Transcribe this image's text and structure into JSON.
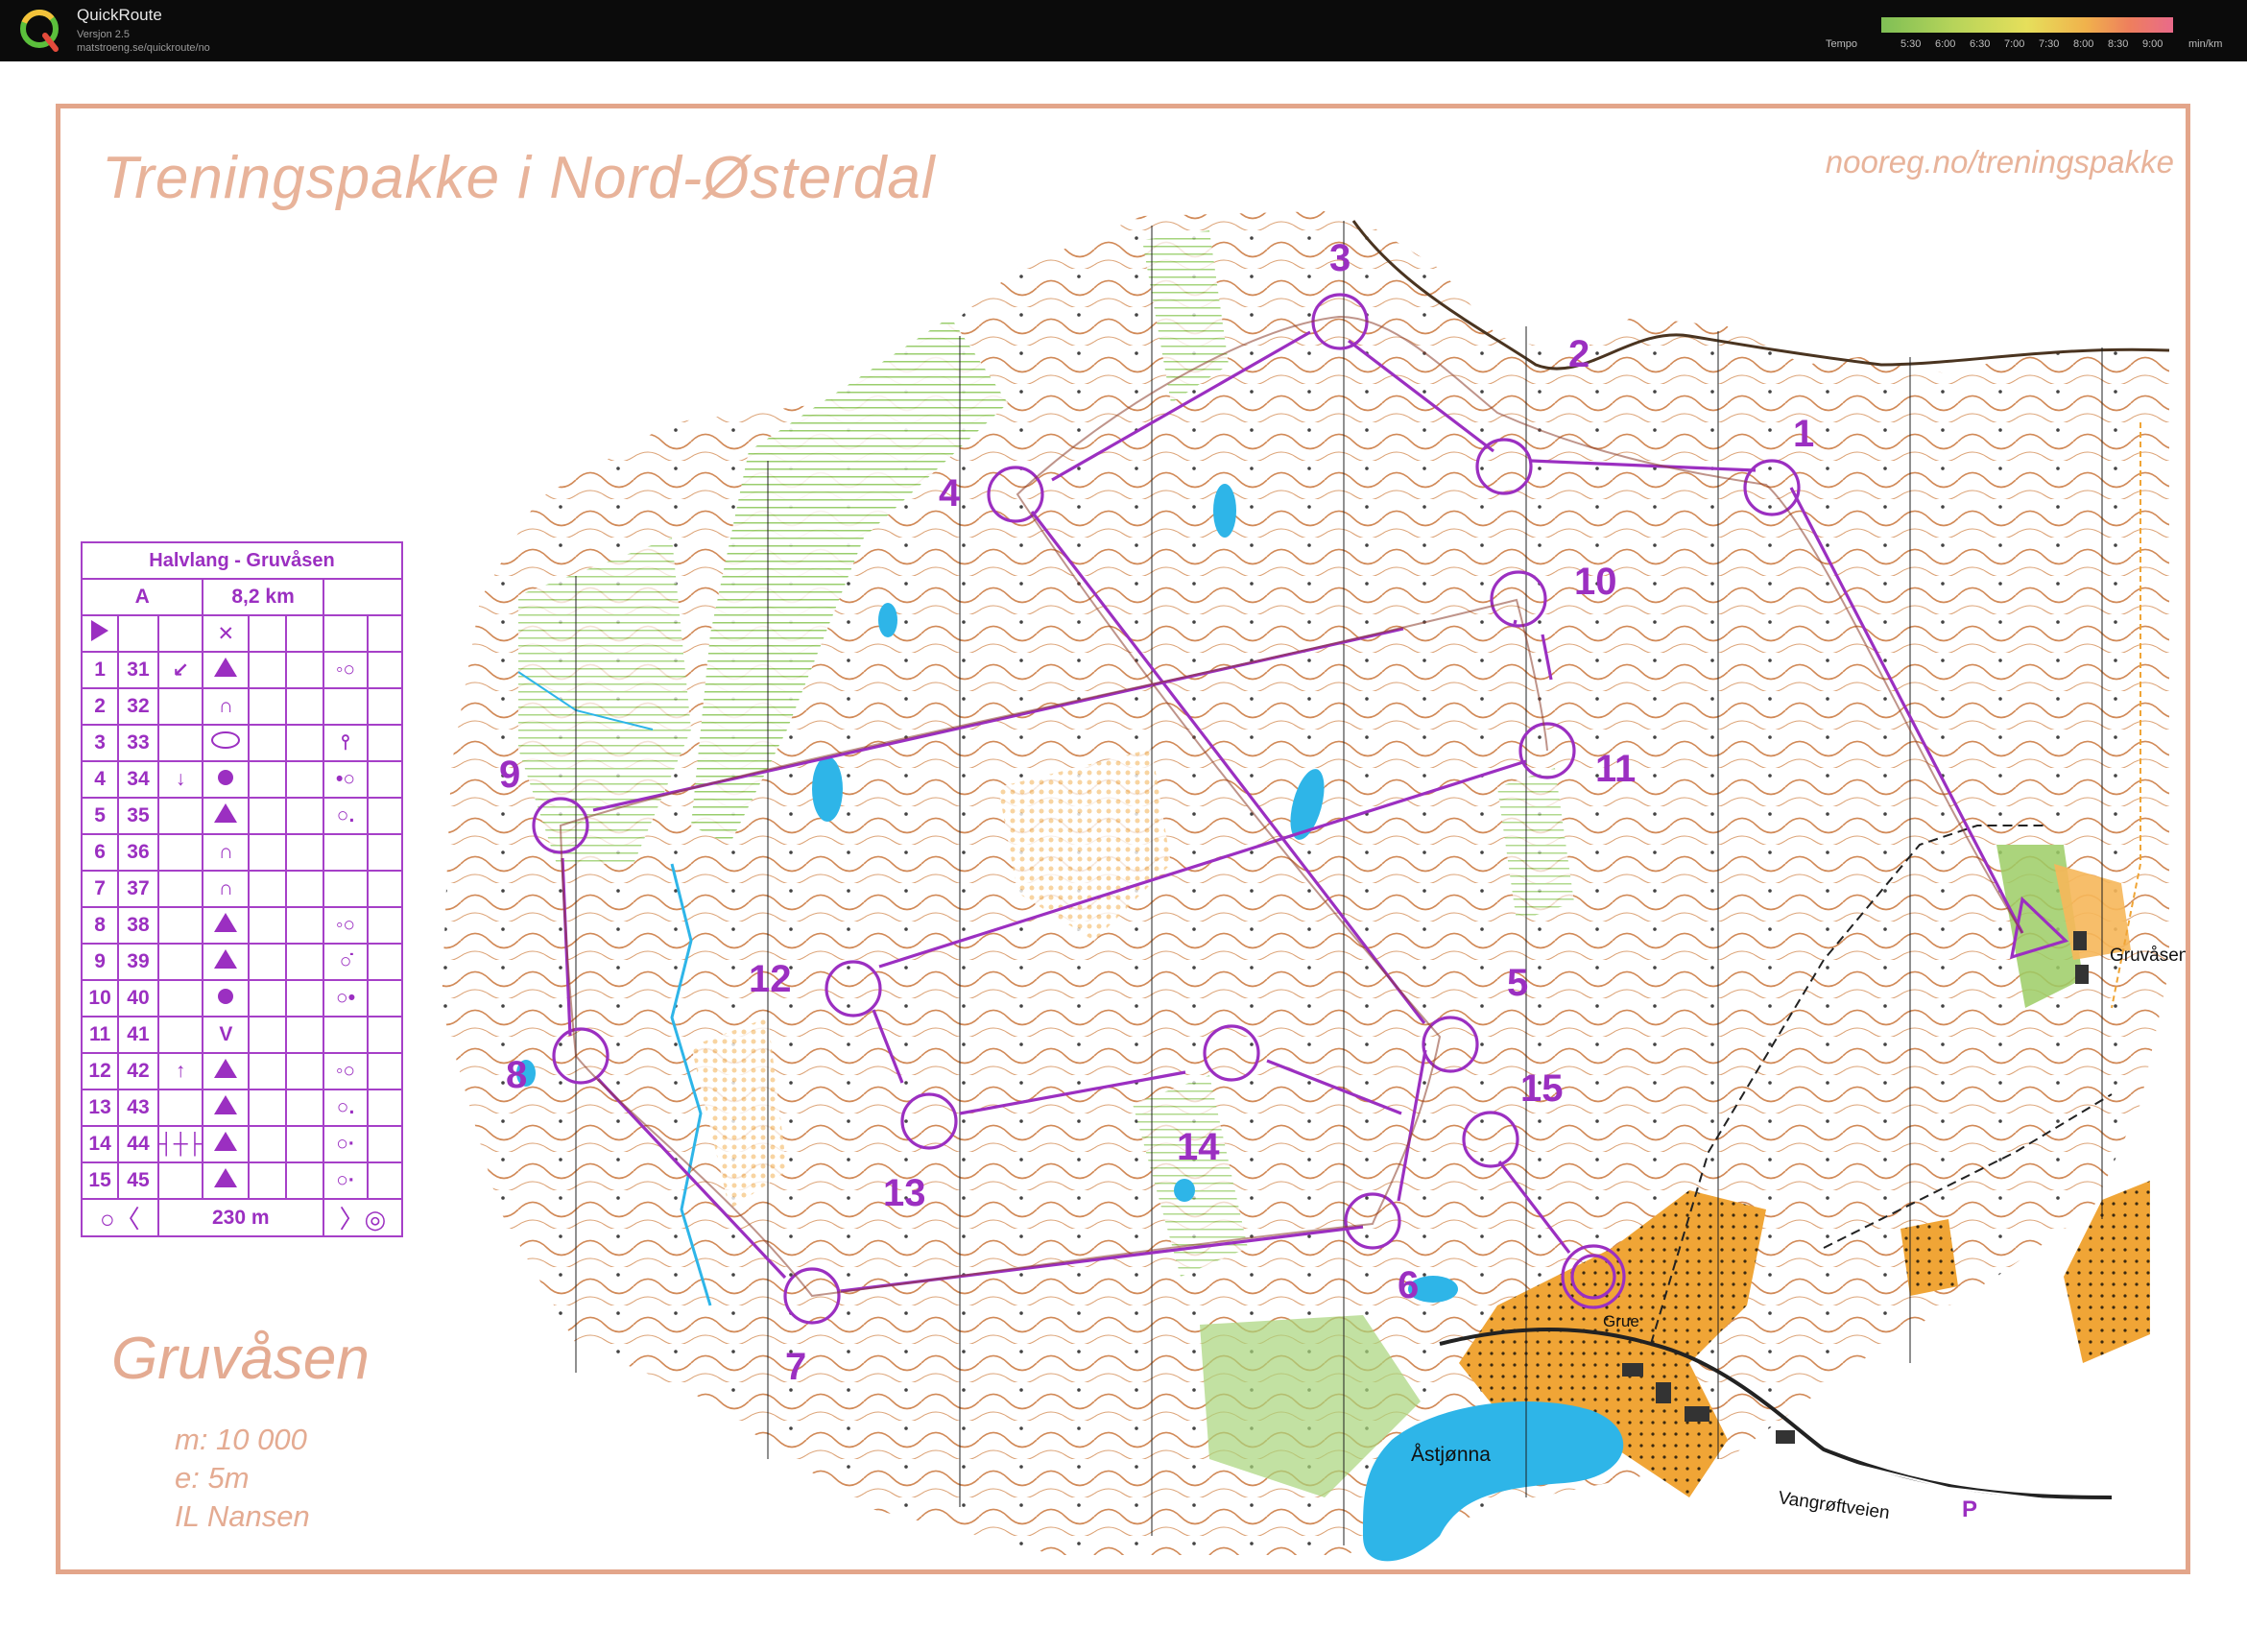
{
  "app": {
    "name": "QuickRoute",
    "version": "Versjon 2.5",
    "url": "matstroeng.se/quickroute/no",
    "tempo_label": "Tempo",
    "tempo_ticks": [
      "5:30",
      "6:00",
      "6:30",
      "7:00",
      "7:30",
      "8:00",
      "8:30",
      "9:00"
    ],
    "tempo_unit": "min/km"
  },
  "map": {
    "title": "Treningspakke i Nord-Østerdal",
    "url": "nooreg.no/treningspakke",
    "area_name": "Gruvåsen",
    "scale": "m: 10 000",
    "equidistance": "e:  5m",
    "club": "IL Nansen",
    "place_labels": {
      "gruvasen": "Gruvåsen",
      "grue": "Grue",
      "astjonna": "Åstjønna",
      "road": "Vangrøftveien",
      "parking": "P"
    },
    "controls": [
      {
        "num": "1"
      },
      {
        "num": "2"
      },
      {
        "num": "3"
      },
      {
        "num": "4"
      },
      {
        "num": "5"
      },
      {
        "num": "6"
      },
      {
        "num": "7"
      },
      {
        "num": "8"
      },
      {
        "num": "9"
      },
      {
        "num": "10"
      },
      {
        "num": "11"
      },
      {
        "num": "12"
      },
      {
        "num": "13"
      },
      {
        "num": "14"
      },
      {
        "num": "15"
      }
    ],
    "colors": {
      "course": "#9b2fc1",
      "frame": "#e3a58a",
      "water": "#2eb5e8",
      "contour": "#c9753a",
      "vegetation": "#9ccc65",
      "open_land": "#f1b96a",
      "settlement": "#f0a536"
    }
  },
  "description": {
    "course_name": "Halvlang - Gruvåsen",
    "class": "A",
    "length": "8,2 km",
    "finish_distance": "230 m",
    "rows": [
      {
        "num": "1",
        "code": "31",
        "dir": "↙",
        "feature": "triangle",
        "extra": "◦○"
      },
      {
        "num": "2",
        "code": "32",
        "dir": "",
        "feature": "∩",
        "extra": ""
      },
      {
        "num": "3",
        "code": "33",
        "dir": "",
        "feature": "oval",
        "extra": "⫯"
      },
      {
        "num": "4",
        "code": "34",
        "dir": "↓",
        "feature": "dot",
        "extra": "•○"
      },
      {
        "num": "5",
        "code": "35",
        "dir": "",
        "feature": "triangle",
        "extra": "○."
      },
      {
        "num": "6",
        "code": "36",
        "dir": "",
        "feature": "∩",
        "extra": ""
      },
      {
        "num": "7",
        "code": "37",
        "dir": "",
        "feature": "∩",
        "extra": ""
      },
      {
        "num": "8",
        "code": "38",
        "dir": "",
        "feature": "triangle",
        "extra": "◦○"
      },
      {
        "num": "9",
        "code": "39",
        "dir": "",
        "feature": "triangle",
        "extra": "○̇"
      },
      {
        "num": "10",
        "code": "40",
        "dir": "",
        "feature": "dot",
        "extra": "○•"
      },
      {
        "num": "11",
        "code": "41",
        "dir": "",
        "feature": "V",
        "extra": ""
      },
      {
        "num": "12",
        "code": "42",
        "dir": "↑",
        "feature": "triangle",
        "extra": "◦○"
      },
      {
        "num": "13",
        "code": "43",
        "dir": "",
        "feature": "triangle",
        "extra": "○."
      },
      {
        "num": "14",
        "code": "44",
        "dir": "┤┼├",
        "feature": "triangle",
        "extra": "○·"
      },
      {
        "num": "15",
        "code": "45",
        "dir": "",
        "feature": "triangle",
        "extra": "○·"
      }
    ]
  }
}
